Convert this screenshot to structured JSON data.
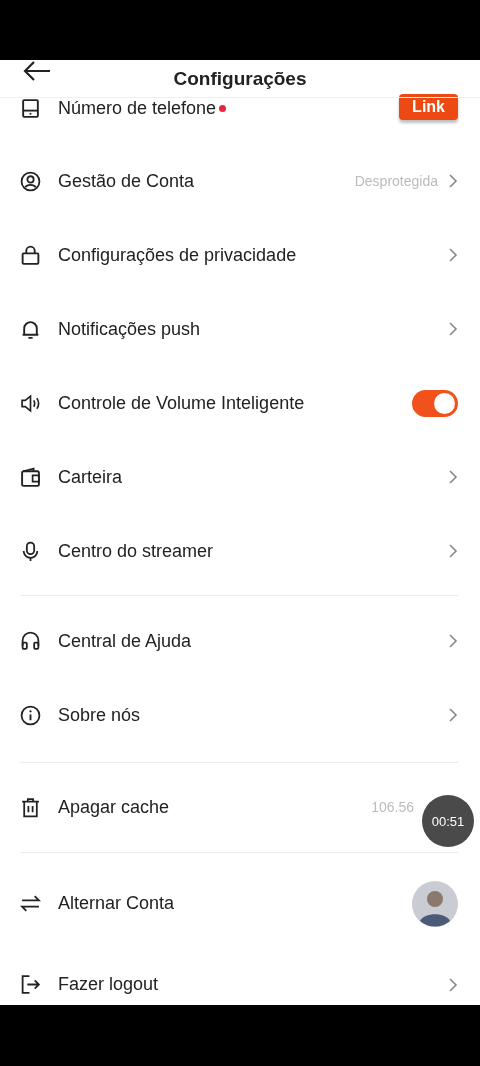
{
  "header": {
    "title": "Configurações"
  },
  "sections": [
    {
      "rows": [
        {
          "kind": "link",
          "label": "Número de telefone",
          "dot": true,
          "button": "Link"
        },
        {
          "kind": "value",
          "label": "Gestão de Conta",
          "value": "Desprotegida"
        },
        {
          "kind": "arrow",
          "label": "Configurações de privacidade"
        },
        {
          "kind": "arrow",
          "label": "Notificações push"
        },
        {
          "kind": "toggle",
          "label": "Controle de Volume Inteligente",
          "on": true
        },
        {
          "kind": "arrow",
          "label": "Carteira"
        },
        {
          "kind": "arrow",
          "label": "Centro do streamer"
        }
      ]
    },
    {
      "rows": [
        {
          "kind": "arrow",
          "label": "Central de Ajuda"
        },
        {
          "kind": "arrow",
          "label": "Sobre nós"
        }
      ]
    },
    {
      "rows": [
        {
          "kind": "plain",
          "label": "Apagar cache",
          "value": "106.56"
        }
      ]
    },
    {
      "rows": [
        {
          "kind": "avatar",
          "label": "Alternar Conta"
        },
        {
          "kind": "arrow",
          "label": "Fazer logout"
        }
      ]
    }
  ],
  "recording_timer": "00:51"
}
